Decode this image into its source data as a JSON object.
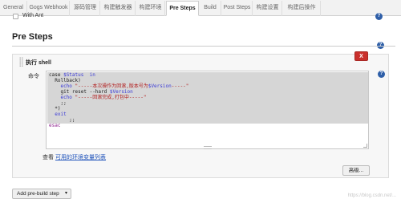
{
  "tabs": [
    {
      "label": "General",
      "active": false
    },
    {
      "label": "Gogs Webhook",
      "active": false
    },
    {
      "label": "源码管理",
      "active": false
    },
    {
      "label": "构建触发器",
      "active": false
    },
    {
      "label": "构建环境",
      "active": false
    },
    {
      "label": "Pre Steps",
      "active": true
    },
    {
      "label": "Build",
      "active": false
    },
    {
      "label": "Post Steps",
      "active": false
    },
    {
      "label": "构建设置",
      "active": false
    },
    {
      "label": "构建后操作",
      "active": false
    }
  ],
  "with_ant": {
    "label": "With Ant",
    "checked": false
  },
  "help_icon": "?",
  "section": {
    "title": "Pre Steps"
  },
  "step": {
    "title": "执行 shell",
    "delete_label": "X",
    "command_label": "命令",
    "code": {
      "l1_kw": "case",
      "l1_var": "$Status",
      "l1_in": "in",
      "l2": "Rollback)",
      "l3_echo": "echo",
      "l3_str": "\"-----本次操作为回滚,版本号为",
      "l3_var": "$Version",
      "l3_end": "-----\"",
      "l4_cmd": "git reset --hard",
      "l4_var": "$Version",
      "l5_echo": "echo",
      "l5_str": "\"-----回滚完成,打包中-----\"",
      "l6": ";;",
      "l7": "*)",
      "l8": "exit",
      "l9": ";;",
      "l10": "esac"
    },
    "env_prefix": "查看",
    "env_link": "可用的环境变量列表",
    "advanced_label": "高级..."
  },
  "add_prebuild": {
    "label": "Add pre-build step",
    "caret": "▾"
  },
  "watermark": "https://blog.csdn.net/...",
  "colors": {
    "active_tab_bg": "#ffffff",
    "delete": "#c9302c",
    "link": "#2255bb",
    "help": "#2f5fa8"
  }
}
